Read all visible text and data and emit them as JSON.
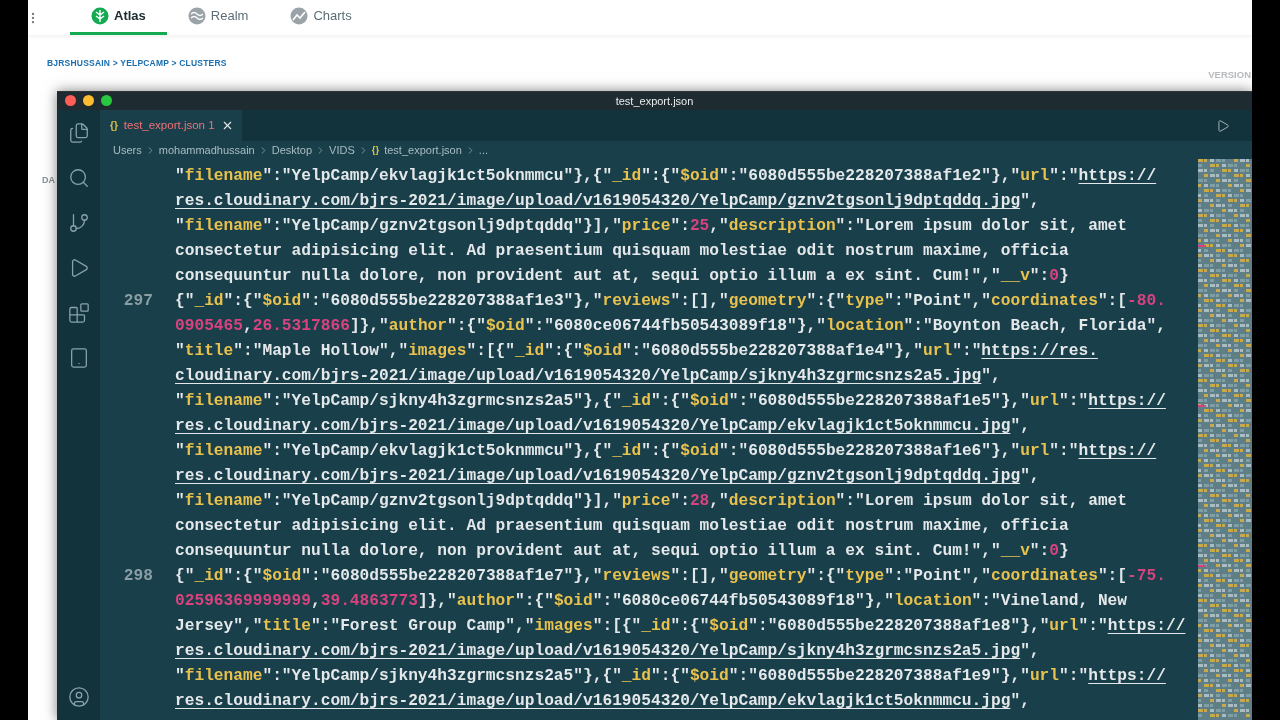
{
  "top_nav": {
    "tabs": [
      {
        "label": "Atlas",
        "selected": true
      },
      {
        "label": "Realm",
        "selected": false
      },
      {
        "label": "Charts",
        "selected": false
      }
    ]
  },
  "page": {
    "breadcrumb": "BJRSHUSSAIN > YELPCAMP > CLUSTERS",
    "version_label": "VERSION",
    "sidebar_fragment": "DA"
  },
  "editor_window": {
    "title": "test_export.json",
    "tabs": [
      {
        "icon": "{}",
        "name": "test_export.json",
        "problems": "1",
        "selected": true
      }
    ],
    "breadcrumb": [
      {
        "text": "Users"
      },
      {
        "text": "mohammadhussain"
      },
      {
        "text": "Desktop"
      },
      {
        "text": "VIDS"
      },
      {
        "icon": "{}",
        "text": "test_export.json"
      },
      {
        "text": "..."
      }
    ],
    "lines": [
      {
        "tokens": [
          {
            "kind": "plain",
            "text": "\""
          },
          {
            "kind": "key",
            "text": "filename"
          },
          {
            "kind": "plain",
            "text": "\":\"YelpCamp/ekvlagjk1ct5oknmmcu\"},{\""
          },
          {
            "kind": "key",
            "text": "_id"
          },
          {
            "kind": "plain",
            "text": "\":{\""
          },
          {
            "kind": "key",
            "text": "$oid"
          },
          {
            "kind": "plain",
            "text": "\":\"6080d555be228207388af1e2\"},\""
          },
          {
            "kind": "key",
            "text": "url"
          },
          {
            "kind": "plain",
            "text": "\":\""
          },
          {
            "kind": "link",
            "text": "https://"
          }
        ]
      },
      {
        "tokens": [
          {
            "kind": "link",
            "text": "res.cloudinary.com/bjrs-2021/image/upload/v1619054320/YelpCamp/gznv2tgsonlj9dptqddq.jpg"
          },
          {
            "kind": "plain",
            "text": "\","
          }
        ]
      },
      {
        "tokens": [
          {
            "kind": "plain",
            "text": "\""
          },
          {
            "kind": "key",
            "text": "filename"
          },
          {
            "kind": "plain",
            "text": "\":\"YelpCamp/gznv2tgsonlj9dptqddq\"}],\""
          },
          {
            "kind": "key",
            "text": "price"
          },
          {
            "kind": "plain",
            "text": "\":"
          },
          {
            "kind": "number",
            "text": "25"
          },
          {
            "kind": "plain",
            "text": ",\""
          },
          {
            "kind": "key",
            "text": "description"
          },
          {
            "kind": "plain",
            "text": "\":\"Lorem ipsum dolor sit, amet"
          }
        ]
      },
      {
        "tokens": [
          {
            "kind": "plain",
            "text": "consectetur adipisicing elit. Ad praesentium quisquam molestiae odit nostrum maxime, officia"
          }
        ]
      },
      {
        "tokens": [
          {
            "kind": "plain",
            "text": "consequuntur nulla dolore, non provident aut at, sequi optio illum a ex sint. Cum!\",\""
          },
          {
            "kind": "key",
            "text": "__v"
          },
          {
            "kind": "plain",
            "text": "\":"
          },
          {
            "kind": "number",
            "text": "0"
          },
          {
            "kind": "plain",
            "text": "}"
          }
        ]
      },
      {
        "number": "297",
        "tokens": [
          {
            "kind": "plain",
            "text": "{\""
          },
          {
            "kind": "key",
            "text": "_id"
          },
          {
            "kind": "plain",
            "text": "\":{\""
          },
          {
            "kind": "key",
            "text": "$oid"
          },
          {
            "kind": "plain",
            "text": "\":\"6080d555be228207388af1e3\"},\""
          },
          {
            "kind": "key",
            "text": "reviews"
          },
          {
            "kind": "plain",
            "text": "\":[],\""
          },
          {
            "kind": "key",
            "text": "geometry"
          },
          {
            "kind": "plain",
            "text": "\":{\""
          },
          {
            "kind": "key",
            "text": "type"
          },
          {
            "kind": "plain",
            "text": "\":\"Point\",\""
          },
          {
            "kind": "key",
            "text": "coordinates"
          },
          {
            "kind": "plain",
            "text": "\":["
          },
          {
            "kind": "number",
            "text": "-80."
          }
        ]
      },
      {
        "tokens": [
          {
            "kind": "number",
            "text": "0905465"
          },
          {
            "kind": "plain",
            "text": ","
          },
          {
            "kind": "number",
            "text": "26.5317866"
          },
          {
            "kind": "plain",
            "text": "]},\""
          },
          {
            "kind": "key",
            "text": "author"
          },
          {
            "kind": "plain",
            "text": "\":{\""
          },
          {
            "kind": "key",
            "text": "$oid"
          },
          {
            "kind": "plain",
            "text": "\":\"6080ce06744fb50543089f18\"},\""
          },
          {
            "kind": "key",
            "text": "location"
          },
          {
            "kind": "plain",
            "text": "\":\"Boynton Beach, Florida\","
          }
        ]
      },
      {
        "tokens": [
          {
            "kind": "plain",
            "text": "\""
          },
          {
            "kind": "key",
            "text": "title"
          },
          {
            "kind": "plain",
            "text": "\":\"Maple Hollow\",\""
          },
          {
            "kind": "key",
            "text": "images"
          },
          {
            "kind": "plain",
            "text": "\":[{\""
          },
          {
            "kind": "key",
            "text": "_id"
          },
          {
            "kind": "plain",
            "text": "\":{\""
          },
          {
            "kind": "key",
            "text": "$oid"
          },
          {
            "kind": "plain",
            "text": "\":\"6080d555be228207388af1e4\"},\""
          },
          {
            "kind": "key",
            "text": "url"
          },
          {
            "kind": "plain",
            "text": "\":\""
          },
          {
            "kind": "link",
            "text": "https://res."
          }
        ]
      },
      {
        "tokens": [
          {
            "kind": "link",
            "text": "cloudinary.com/bjrs-2021/image/upload/v1619054320/YelpCamp/sjkny4h3zgrmcsnzs2a5.jpg"
          },
          {
            "kind": "plain",
            "text": "\","
          }
        ]
      },
      {
        "tokens": [
          {
            "kind": "plain",
            "text": "\""
          },
          {
            "kind": "key",
            "text": "filename"
          },
          {
            "kind": "plain",
            "text": "\":\"YelpCamp/sjkny4h3zgrmcsnzs2a5\"},{\""
          },
          {
            "kind": "key",
            "text": "_id"
          },
          {
            "kind": "plain",
            "text": "\":{\""
          },
          {
            "kind": "key",
            "text": "$oid"
          },
          {
            "kind": "plain",
            "text": "\":\"6080d555be228207388af1e5\"},\""
          },
          {
            "kind": "key",
            "text": "url"
          },
          {
            "kind": "plain",
            "text": "\":\""
          },
          {
            "kind": "link",
            "text": "https://"
          }
        ]
      },
      {
        "tokens": [
          {
            "kind": "link",
            "text": "res.cloudinary.com/bjrs-2021/image/upload/v1619054320/YelpCamp/ekvlagjk1ct5oknmmcu.jpg"
          },
          {
            "kind": "plain",
            "text": "\","
          }
        ]
      },
      {
        "tokens": [
          {
            "kind": "plain",
            "text": "\""
          },
          {
            "kind": "key",
            "text": "filename"
          },
          {
            "kind": "plain",
            "text": "\":\"YelpCamp/ekvlagjk1ct5oknmmcu\"},{\""
          },
          {
            "kind": "key",
            "text": "_id"
          },
          {
            "kind": "plain",
            "text": "\":{\""
          },
          {
            "kind": "key",
            "text": "$oid"
          },
          {
            "kind": "plain",
            "text": "\":\"6080d555be228207388af1e6\"},\""
          },
          {
            "kind": "key",
            "text": "url"
          },
          {
            "kind": "plain",
            "text": "\":\""
          },
          {
            "kind": "link",
            "text": "https://"
          }
        ]
      },
      {
        "tokens": [
          {
            "kind": "link",
            "text": "res.cloudinary.com/bjrs-2021/image/upload/v1619054320/YelpCamp/gznv2tgsonlj9dptqddq.jpg"
          },
          {
            "kind": "plain",
            "text": "\","
          }
        ]
      },
      {
        "tokens": [
          {
            "kind": "plain",
            "text": "\""
          },
          {
            "kind": "key",
            "text": "filename"
          },
          {
            "kind": "plain",
            "text": "\":\"YelpCamp/gznv2tgsonlj9dptqddq\"}],\""
          },
          {
            "kind": "key",
            "text": "price"
          },
          {
            "kind": "plain",
            "text": "\":"
          },
          {
            "kind": "number",
            "text": "28"
          },
          {
            "kind": "plain",
            "text": ",\""
          },
          {
            "kind": "key",
            "text": "description"
          },
          {
            "kind": "plain",
            "text": "\":\"Lorem ipsum dolor sit, amet"
          }
        ]
      },
      {
        "tokens": [
          {
            "kind": "plain",
            "text": "consectetur adipisicing elit. Ad praesentium quisquam molestiae odit nostrum maxime, officia"
          }
        ]
      },
      {
        "tokens": [
          {
            "kind": "plain",
            "text": "consequuntur nulla dolore, non provident aut at, sequi optio illum a ex sint. Cum!\",\""
          },
          {
            "kind": "key",
            "text": "__v"
          },
          {
            "kind": "plain",
            "text": "\":"
          },
          {
            "kind": "number",
            "text": "0"
          },
          {
            "kind": "plain",
            "text": "}"
          }
        ]
      },
      {
        "number": "298",
        "tokens": [
          {
            "kind": "plain",
            "text": "{\""
          },
          {
            "kind": "key",
            "text": "_id"
          },
          {
            "kind": "plain",
            "text": "\":{\""
          },
          {
            "kind": "key",
            "text": "$oid"
          },
          {
            "kind": "plain",
            "text": "\":\"6080d555be228207388af1e7\"},\""
          },
          {
            "kind": "key",
            "text": "reviews"
          },
          {
            "kind": "plain",
            "text": "\":[],\""
          },
          {
            "kind": "key",
            "text": "geometry"
          },
          {
            "kind": "plain",
            "text": "\":{\""
          },
          {
            "kind": "key",
            "text": "type"
          },
          {
            "kind": "plain",
            "text": "\":\"Point\",\""
          },
          {
            "kind": "key",
            "text": "coordinates"
          },
          {
            "kind": "plain",
            "text": "\":["
          },
          {
            "kind": "number",
            "text": "-75."
          }
        ]
      },
      {
        "tokens": [
          {
            "kind": "number",
            "text": "02596369999999"
          },
          {
            "kind": "plain",
            "text": ","
          },
          {
            "kind": "number",
            "text": "39.4863773"
          },
          {
            "kind": "plain",
            "text": "]},\""
          },
          {
            "kind": "key",
            "text": "author"
          },
          {
            "kind": "plain",
            "text": "\":{\""
          },
          {
            "kind": "key",
            "text": "$oid"
          },
          {
            "kind": "plain",
            "text": "\":\"6080ce06744fb50543089f18\"},\""
          },
          {
            "kind": "key",
            "text": "location"
          },
          {
            "kind": "plain",
            "text": "\":\"Vineland, New"
          }
        ]
      },
      {
        "tokens": [
          {
            "kind": "plain",
            "text": "Jersey\",\""
          },
          {
            "kind": "key",
            "text": "title"
          },
          {
            "kind": "plain",
            "text": "\":\"Forest Group Camp\",\""
          },
          {
            "kind": "key",
            "text": "images"
          },
          {
            "kind": "plain",
            "text": "\":[{\""
          },
          {
            "kind": "key",
            "text": "_id"
          },
          {
            "kind": "plain",
            "text": "\":{\""
          },
          {
            "kind": "key",
            "text": "$oid"
          },
          {
            "kind": "plain",
            "text": "\":\"6080d555be228207388af1e8\"},\""
          },
          {
            "kind": "key",
            "text": "url"
          },
          {
            "kind": "plain",
            "text": "\":\""
          },
          {
            "kind": "link",
            "text": "https://"
          }
        ]
      },
      {
        "tokens": [
          {
            "kind": "link",
            "text": "res.cloudinary.com/bjrs-2021/image/upload/v1619054320/YelpCamp/sjkny4h3zgrmcsnzs2a5.jpg"
          },
          {
            "kind": "plain",
            "text": "\","
          }
        ]
      },
      {
        "tokens": [
          {
            "kind": "plain",
            "text": "\""
          },
          {
            "kind": "key",
            "text": "filename"
          },
          {
            "kind": "plain",
            "text": "\":\"YelpCamp/sjkny4h3zgrmcsnzs2a5\"},{\""
          },
          {
            "kind": "key",
            "text": "_id"
          },
          {
            "kind": "plain",
            "text": "\":{\""
          },
          {
            "kind": "key",
            "text": "$oid"
          },
          {
            "kind": "plain",
            "text": "\":\"6080d555be228207388af1e9\"},\""
          },
          {
            "kind": "key",
            "text": "url"
          },
          {
            "kind": "plain",
            "text": "\":\""
          },
          {
            "kind": "link",
            "text": "https://"
          }
        ]
      },
      {
        "tokens": [
          {
            "kind": "link",
            "text": "res.cloudinary.com/bjrs-2021/image/upload/v1619054320/YelpCamp/ekvlagjk1ct5oknmmcu.jpg"
          },
          {
            "kind": "plain",
            "text": "\","
          }
        ]
      }
    ]
  }
}
